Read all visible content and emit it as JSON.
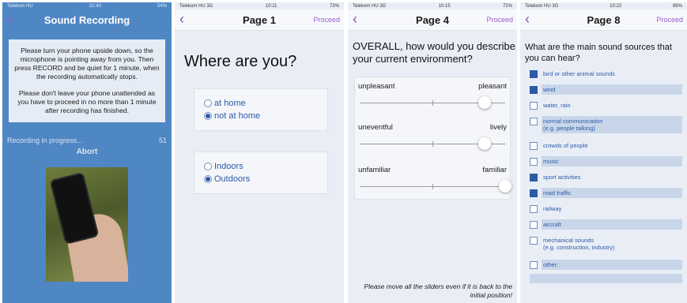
{
  "screens": [
    {
      "status": {
        "carrier": "Telekom HU",
        "time": "21:40",
        "battery": "54%"
      },
      "title": "Sound Recording",
      "instructions": [
        "Please turn your phone upside down, so the microphone is pointing away from you. Then press RECORD and be quiet for 1 minute, when the recording automatically stops.",
        "Please don't leave your phone unattended as you have to proceed in no more than 1 minute after recording has finished."
      ],
      "progress_label": "Recording in progress...",
      "progress_count": "51",
      "abort_label": "Abort"
    },
    {
      "status": {
        "carrier": "Telekom HU 3G",
        "time": "10:11",
        "battery": "73%"
      },
      "title": "Page 1",
      "proceed_label": "Proceed",
      "question": "Where are you?",
      "group1": [
        {
          "label": "at home",
          "selected": false
        },
        {
          "label": "not at home",
          "selected": true
        }
      ],
      "group2": [
        {
          "label": "Indoors",
          "selected": false
        },
        {
          "label": "Outdoors",
          "selected": true
        }
      ]
    },
    {
      "status": {
        "carrier": "Telekom HU 3G",
        "time": "10:15",
        "battery": "72%"
      },
      "title": "Page 4",
      "proceed_label": "Proceed",
      "question": "OVERALL, how would you describe your current environment?",
      "sliders": [
        {
          "left": "unpleasant",
          "right": "pleasant",
          "value": 0.86
        },
        {
          "left": "uneventful",
          "right": "lively",
          "value": 0.86
        },
        {
          "left": "unfamiliar",
          "right": "familiar",
          "value": 1.0
        }
      ],
      "note": "Please move all the sliders even if it is back to the initial position!"
    },
    {
      "status": {
        "carrier": "Telekom HU 3G",
        "time": "10:22",
        "battery": "69%"
      },
      "title": "Page 8",
      "proceed_label": "Proceed",
      "question": "What are the main sound sources that you can hear?",
      "options": [
        {
          "label": "bird or other animal sounds",
          "checked": true
        },
        {
          "label": "wind",
          "checked": true
        },
        {
          "label": "water, rain",
          "checked": false
        },
        {
          "label": "normal communication",
          "sublabel": "(e.g. people talking)",
          "checked": false
        },
        {
          "label": "crowds of people",
          "checked": false
        },
        {
          "label": "music",
          "checked": false
        },
        {
          "label": "sport activities",
          "checked": true
        },
        {
          "label": "road traffic",
          "checked": true
        },
        {
          "label": "railway",
          "checked": false
        },
        {
          "label": "aircraft",
          "checked": false
        },
        {
          "label": "mechanical sounds",
          "sublabel": "(e.g. construction, industry)",
          "checked": false
        },
        {
          "label": "other:",
          "checked": false
        }
      ]
    }
  ]
}
